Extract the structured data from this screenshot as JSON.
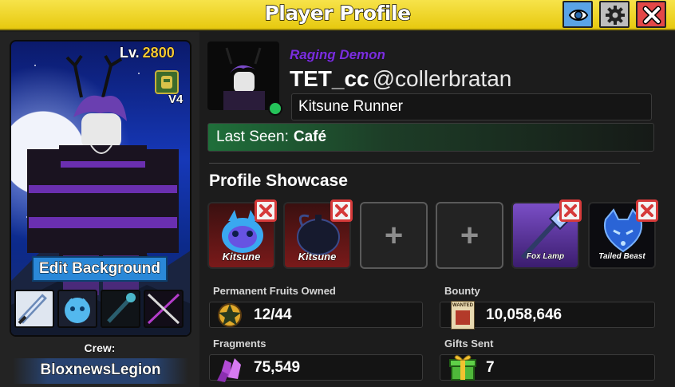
{
  "window": {
    "title": "Player Profile"
  },
  "left": {
    "level_label": "Lv.",
    "level_value": "2800",
    "race_version": "V4",
    "edit_background_label": "Edit Background",
    "crew_label": "Crew:",
    "crew_name": "BloxnewsLegion"
  },
  "profile": {
    "title_tag": "Raging Demon",
    "display_name": "TET_cc",
    "username": "@collerbratan",
    "subtitle": "Kitsune Runner",
    "last_seen_label": "Last Seen:",
    "last_seen_value": "Café",
    "online_status": "online"
  },
  "showcase": {
    "title": "Profile Showcase",
    "slots": [
      {
        "type": "fruit",
        "label": "Kitsune",
        "icon": "kitsune-fruit-icon",
        "removable": true
      },
      {
        "type": "fruit",
        "label": "Kitsune",
        "icon": "kitsune-fruit-dark-icon",
        "removable": true
      },
      {
        "type": "empty",
        "label": "+",
        "removable": false
      },
      {
        "type": "empty",
        "label": "+",
        "removable": false
      },
      {
        "type": "gear",
        "label": "Fox Lamp",
        "icon": "fox-lamp-icon",
        "removable": true
      },
      {
        "type": "beast",
        "label": "Tailed Beast",
        "icon": "tailed-beast-icon",
        "removable": true
      }
    ]
  },
  "stats": {
    "permanent_fruits_label": "Permanent Fruits Owned",
    "permanent_fruits_value": "12/44",
    "bounty_label": "Bounty",
    "bounty_value": "10,058,646",
    "fragments_label": "Fragments",
    "fragments_value": "75,549",
    "gifts_label": "Gifts Sent",
    "gifts_value": "7",
    "bounty_poster_text": "WANTED"
  },
  "colors": {
    "titlebar": "#f0d52a",
    "online": "#25c35a",
    "title_tag": "#7a2fdc",
    "level_value": "#f4c838",
    "close_button": "#e34848",
    "eye_button": "#5aa3e6"
  }
}
